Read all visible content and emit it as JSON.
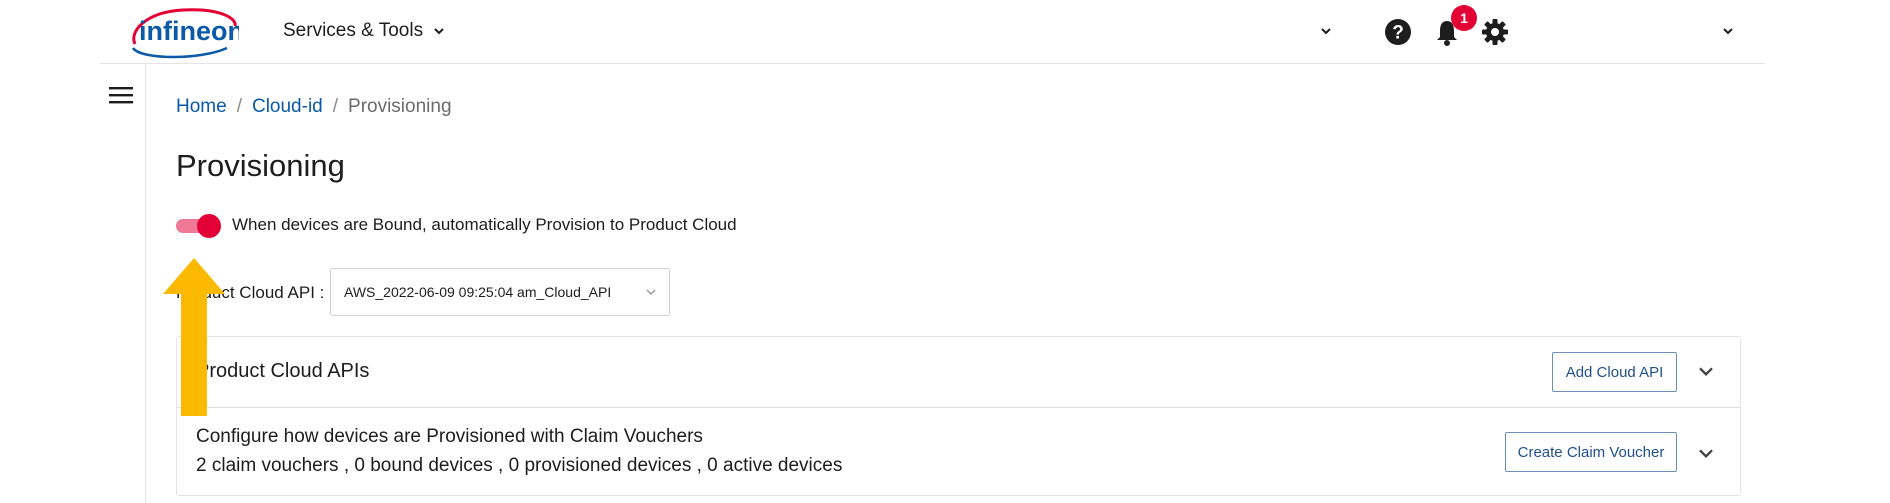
{
  "header": {
    "logo_text": "infineon",
    "services_menu_label": "Services & Tools",
    "notification_count": "1",
    "icons": [
      "help-icon",
      "bell-icon",
      "gear-icon",
      "chevron-down-icon"
    ]
  },
  "breadcrumb": {
    "items": [
      "Home",
      "Cloud-id",
      "Provisioning"
    ],
    "separator": "/"
  },
  "page": {
    "title": "Provisioning",
    "toggle_label": "When devices are Bound, automatically Provision to Product Cloud",
    "toggle_on": true,
    "api_select_label": "Product Cloud API :",
    "api_select_value": "AWS_2022-06-09 09:25:04 am_Cloud_API"
  },
  "panel": {
    "row1": {
      "title": "Product Cloud APIs",
      "button_label": "Add Cloud API"
    },
    "row2": {
      "title": "Configure how devices are Provisioned with Claim Vouchers",
      "summary": "2 claim vouchers , 0 bound devices , 0 provisioned devices , 0 active devices",
      "button_label": "Create Claim Voucher"
    }
  },
  "colors": {
    "brand_blue": "#0a5aa8",
    "brand_red": "#e30034",
    "annotation_arrow": "#fbb900"
  }
}
